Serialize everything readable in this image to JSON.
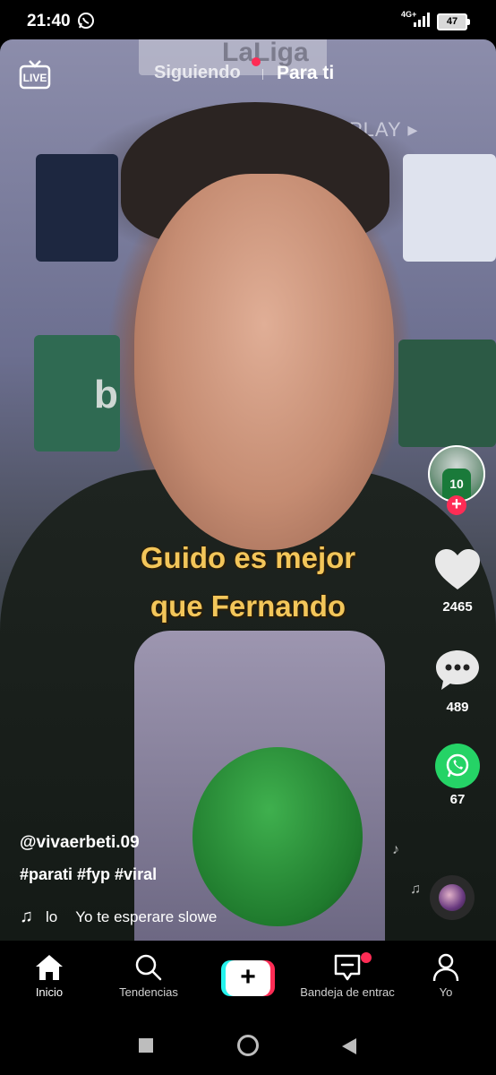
{
  "status_bar": {
    "time": "21:40",
    "network": "4G+",
    "battery": "47"
  },
  "top_nav": {
    "live_label": "LIVE",
    "tab_following": "Siguiendo",
    "tab_for_you": "Para ti"
  },
  "video_overlay": {
    "logo_text": "LaLiga",
    "play_text": "PLAY ▸",
    "sign_letter": "b"
  },
  "caption": {
    "line1": "Guido es mejor",
    "line2": "que Fernando"
  },
  "side_actions": {
    "jersey_number": "10",
    "likes": "2465",
    "comments": "489",
    "shares": "67"
  },
  "post": {
    "username": "@vivaerbeti.09",
    "hashtags": "#parati #fyp #viral",
    "music_prefix": "lo",
    "music_title": "Yo te esperare slowe"
  },
  "bottom_nav": {
    "home": "Inicio",
    "trending": "Tendencias",
    "inbox": "Bandeja de entrac",
    "profile": "Yo"
  },
  "colors": {
    "accent": "#fe2c55",
    "caption": "#f3c65a",
    "whatsapp": "#25d366",
    "create_cyan": "#25f4ee"
  }
}
